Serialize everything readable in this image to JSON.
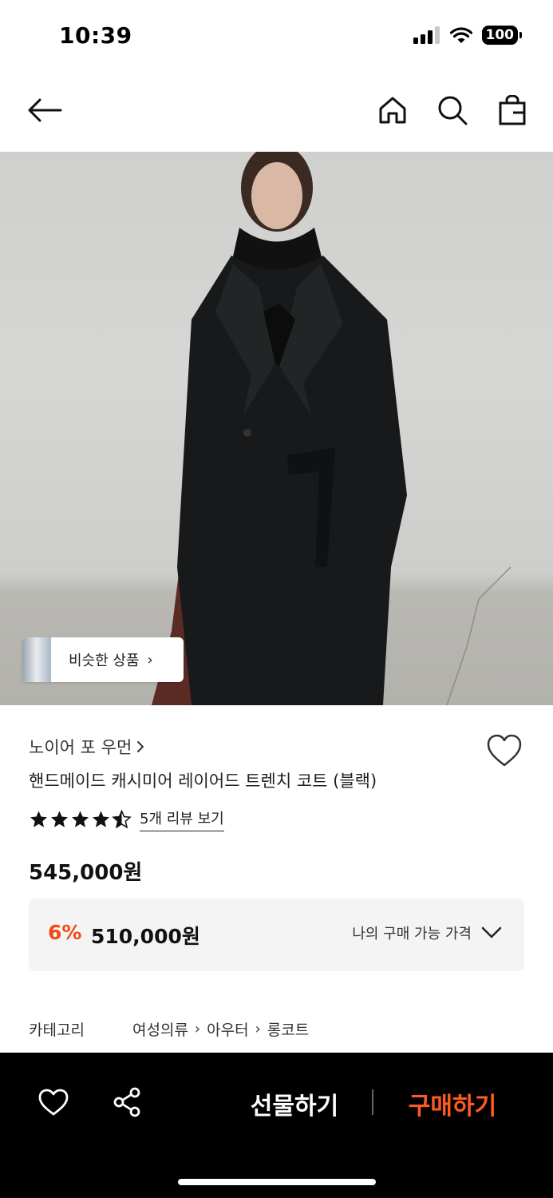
{
  "status_bar": {
    "time": "10:39",
    "battery": "100"
  },
  "nav": {
    "back_icon": "arrow-left-icon",
    "home_icon": "home-icon",
    "search_icon": "search-icon",
    "bag_icon": "shopping-bag-icon"
  },
  "hero": {
    "similar_label": "비슷한 상품"
  },
  "product": {
    "brand": "노이어 포 우먼",
    "name": "핸드메이드 캐시미어 레이어드 트렌치 코트 (블랙)",
    "rating": 4.5,
    "review_link": "5개 리뷰 보기",
    "price": "545,000원",
    "discount_rate": "6%",
    "discount_price": "510,000원",
    "my_price_label": "나의 구매 가능 가격"
  },
  "category": {
    "label": "카테고리",
    "path": [
      "여성의류",
      "아우터",
      "롱코트"
    ]
  },
  "bottom_bar": {
    "gift_label": "선물하기",
    "buy_label": "구매하기"
  },
  "colors": {
    "accent": "#f04a14",
    "buy": "#ff5a1f",
    "bar_bg": "#000000"
  }
}
